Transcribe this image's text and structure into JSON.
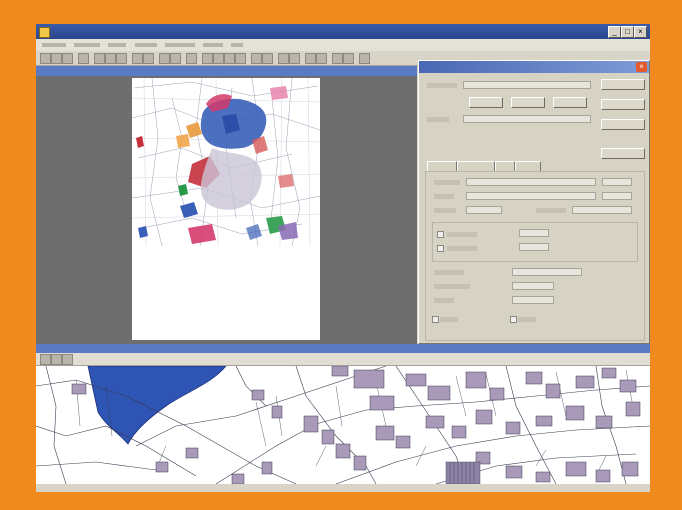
{
  "window": {
    "title": "",
    "app_icon": "app-icon"
  },
  "title_buttons": [
    "_",
    "□",
    "×"
  ],
  "menu": {
    "items": []
  },
  "left_pane": {
    "header": ""
  },
  "dialog": {
    "title": "",
    "close_label": "×",
    "tabs": [
      {
        "label": ""
      },
      {
        "label": ""
      },
      {
        "label": ""
      },
      {
        "label": ""
      }
    ],
    "buttons": [
      {
        "label": ""
      },
      {
        "label": ""
      },
      {
        "label": ""
      },
      {
        "label": ""
      }
    ]
  },
  "bottom_pane": {
    "header": ""
  },
  "status": {
    "left": "",
    "right": ""
  },
  "colors": {
    "frame": "#f08a1f",
    "titlebar": "#2a468e",
    "pane_header": "#5a7bc4",
    "parcel_blue": "#3a5fb8"
  }
}
